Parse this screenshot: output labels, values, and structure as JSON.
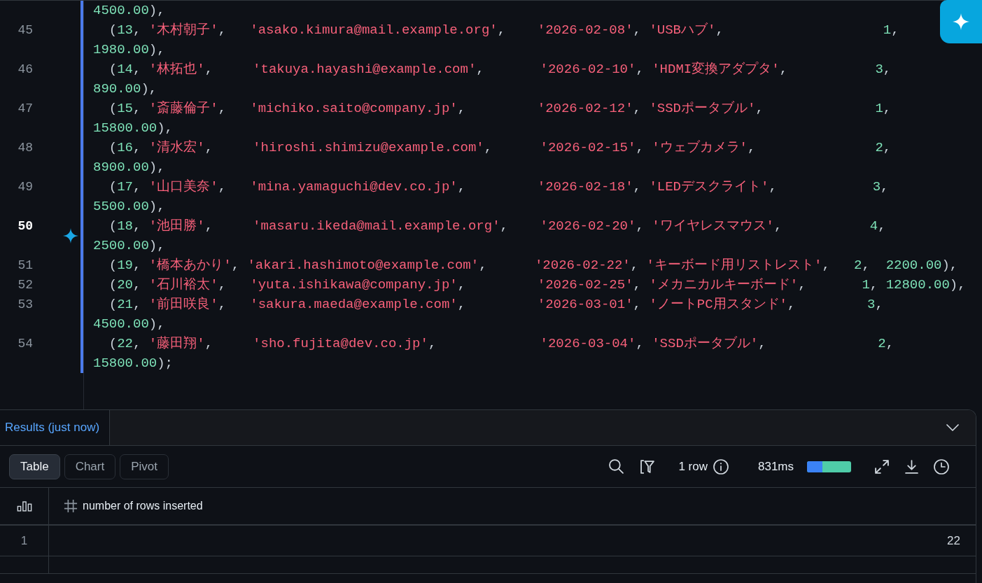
{
  "editor": {
    "lines": [
      {
        "tokens": [
          {
            "kind": "number",
            "text": "4500.00"
          },
          {
            "kind": "punct",
            "text": "),"
          }
        ]
      },
      {
        "number": "45",
        "current": false,
        "tokens": [
          {
            "kind": "punct",
            "text": "  ("
          },
          {
            "kind": "number",
            "text": "13"
          },
          {
            "kind": "punct",
            "text": ", "
          },
          {
            "kind": "string",
            "text": "'木村朝子'"
          },
          {
            "kind": "punct",
            "text": ",   "
          },
          {
            "kind": "string",
            "text": "'asako.kimura@mail.example.org'"
          },
          {
            "kind": "punct",
            "text": ",    "
          },
          {
            "kind": "string",
            "text": "'2026-02-08'"
          },
          {
            "kind": "punct",
            "text": ", "
          },
          {
            "kind": "string",
            "text": "'USBハブ'"
          },
          {
            "kind": "punct",
            "text": ",                    "
          },
          {
            "kind": "number",
            "text": "1"
          },
          {
            "kind": "punct",
            "text": ","
          }
        ],
        "wrapped": [
          {
            "kind": "number",
            "text": "1980.00"
          },
          {
            "kind": "punct",
            "text": "),"
          }
        ]
      },
      {
        "number": "46",
        "current": false,
        "tokens": [
          {
            "kind": "punct",
            "text": "  ("
          },
          {
            "kind": "number",
            "text": "14"
          },
          {
            "kind": "punct",
            "text": ", "
          },
          {
            "kind": "string",
            "text": "'林拓也'"
          },
          {
            "kind": "punct",
            "text": ",     "
          },
          {
            "kind": "string",
            "text": "'takuya.hayashi@example.com'"
          },
          {
            "kind": "punct",
            "text": ",       "
          },
          {
            "kind": "string",
            "text": "'2026-02-10'"
          },
          {
            "kind": "punct",
            "text": ", "
          },
          {
            "kind": "string",
            "text": "'HDMI変換アダプタ'"
          },
          {
            "kind": "punct",
            "text": ",           "
          },
          {
            "kind": "number",
            "text": "3"
          },
          {
            "kind": "punct",
            "text": ","
          }
        ],
        "wrapped": [
          {
            "kind": "number",
            "text": "890.00"
          },
          {
            "kind": "punct",
            "text": "),"
          }
        ]
      },
      {
        "number": "47",
        "current": false,
        "tokens": [
          {
            "kind": "punct",
            "text": "  ("
          },
          {
            "kind": "number",
            "text": "15"
          },
          {
            "kind": "punct",
            "text": ", "
          },
          {
            "kind": "string",
            "text": "'斎藤倫子'"
          },
          {
            "kind": "punct",
            "text": ",   "
          },
          {
            "kind": "string",
            "text": "'michiko.saito@company.jp'"
          },
          {
            "kind": "punct",
            "text": ",         "
          },
          {
            "kind": "string",
            "text": "'2026-02-12'"
          },
          {
            "kind": "punct",
            "text": ", "
          },
          {
            "kind": "string",
            "text": "'SSDポータブル'"
          },
          {
            "kind": "punct",
            "text": ",              "
          },
          {
            "kind": "number",
            "text": "1"
          },
          {
            "kind": "punct",
            "text": ","
          }
        ],
        "wrapped": [
          {
            "kind": "number",
            "text": "15800.00"
          },
          {
            "kind": "punct",
            "text": "),"
          }
        ]
      },
      {
        "number": "48",
        "current": false,
        "tokens": [
          {
            "kind": "punct",
            "text": "  ("
          },
          {
            "kind": "number",
            "text": "16"
          },
          {
            "kind": "punct",
            "text": ", "
          },
          {
            "kind": "string",
            "text": "'清水宏'"
          },
          {
            "kind": "punct",
            "text": ",     "
          },
          {
            "kind": "string",
            "text": "'hiroshi.shimizu@example.com'"
          },
          {
            "kind": "punct",
            "text": ",      "
          },
          {
            "kind": "string",
            "text": "'2026-02-15'"
          },
          {
            "kind": "punct",
            "text": ", "
          },
          {
            "kind": "string",
            "text": "'ウェブカメラ'"
          },
          {
            "kind": "punct",
            "text": ",               "
          },
          {
            "kind": "number",
            "text": "2"
          },
          {
            "kind": "punct",
            "text": ","
          }
        ],
        "wrapped": [
          {
            "kind": "number",
            "text": "8900.00"
          },
          {
            "kind": "punct",
            "text": "),"
          }
        ]
      },
      {
        "number": "49",
        "current": false,
        "tokens": [
          {
            "kind": "punct",
            "text": "  ("
          },
          {
            "kind": "number",
            "text": "17"
          },
          {
            "kind": "punct",
            "text": ", "
          },
          {
            "kind": "string",
            "text": "'山口美奈'"
          },
          {
            "kind": "punct",
            "text": ",   "
          },
          {
            "kind": "string",
            "text": "'mina.yamaguchi@dev.co.jp'"
          },
          {
            "kind": "punct",
            "text": ",         "
          },
          {
            "kind": "string",
            "text": "'2026-02-18'"
          },
          {
            "kind": "punct",
            "text": ", "
          },
          {
            "kind": "string",
            "text": "'LEDデスクライト'"
          },
          {
            "kind": "punct",
            "text": ",            "
          },
          {
            "kind": "number",
            "text": "3"
          },
          {
            "kind": "punct",
            "text": ","
          }
        ],
        "wrapped": [
          {
            "kind": "number",
            "text": "5500.00"
          },
          {
            "kind": "punct",
            "text": "),"
          }
        ]
      },
      {
        "number": "50",
        "current": true,
        "tokens": [
          {
            "kind": "punct",
            "text": "  ("
          },
          {
            "kind": "number",
            "text": "18"
          },
          {
            "kind": "punct",
            "text": ", "
          },
          {
            "kind": "string",
            "text": "'池田勝'"
          },
          {
            "kind": "punct",
            "text": ",     "
          },
          {
            "kind": "string",
            "text": "'masaru.ikeda@mail.example.org'"
          },
          {
            "kind": "punct",
            "text": ",    "
          },
          {
            "kind": "string",
            "text": "'2026-02-20'"
          },
          {
            "kind": "punct",
            "text": ", "
          },
          {
            "kind": "string",
            "text": "'ワイヤレスマウス'"
          },
          {
            "kind": "punct",
            "text": ",           "
          },
          {
            "kind": "number",
            "text": "4"
          },
          {
            "kind": "punct",
            "text": ","
          }
        ],
        "wrapped": [
          {
            "kind": "number",
            "text": "2500.00"
          },
          {
            "kind": "punct",
            "text": "),"
          }
        ]
      },
      {
        "number": "51",
        "current": false,
        "tokens": [
          {
            "kind": "punct",
            "text": "  ("
          },
          {
            "kind": "number",
            "text": "19"
          },
          {
            "kind": "punct",
            "text": ", "
          },
          {
            "kind": "string",
            "text": "'橋本あかり'"
          },
          {
            "kind": "punct",
            "text": ", "
          },
          {
            "kind": "string",
            "text": "'akari.hashimoto@example.com'"
          },
          {
            "kind": "punct",
            "text": ",      "
          },
          {
            "kind": "string",
            "text": "'2026-02-22'"
          },
          {
            "kind": "punct",
            "text": ", "
          },
          {
            "kind": "string",
            "text": "'キーボード用リストレスト'"
          },
          {
            "kind": "punct",
            "text": ",   "
          },
          {
            "kind": "number",
            "text": "2"
          },
          {
            "kind": "punct",
            "text": ",  "
          },
          {
            "kind": "number",
            "text": "2200.00"
          },
          {
            "kind": "punct",
            "text": "),"
          }
        ]
      },
      {
        "number": "52",
        "current": false,
        "tokens": [
          {
            "kind": "punct",
            "text": "  ("
          },
          {
            "kind": "number",
            "text": "20"
          },
          {
            "kind": "punct",
            "text": ", "
          },
          {
            "kind": "string",
            "text": "'石川裕太'"
          },
          {
            "kind": "punct",
            "text": ",   "
          },
          {
            "kind": "string",
            "text": "'yuta.ishikawa@company.jp'"
          },
          {
            "kind": "punct",
            "text": ",         "
          },
          {
            "kind": "string",
            "text": "'2026-02-25'"
          },
          {
            "kind": "punct",
            "text": ", "
          },
          {
            "kind": "string",
            "text": "'メカニカルキーボード'"
          },
          {
            "kind": "punct",
            "text": ",       "
          },
          {
            "kind": "number",
            "text": "1"
          },
          {
            "kind": "punct",
            "text": ", "
          },
          {
            "kind": "number",
            "text": "12800.00"
          },
          {
            "kind": "punct",
            "text": "),"
          }
        ]
      },
      {
        "number": "53",
        "current": false,
        "tokens": [
          {
            "kind": "punct",
            "text": "  ("
          },
          {
            "kind": "number",
            "text": "21"
          },
          {
            "kind": "punct",
            "text": ", "
          },
          {
            "kind": "string",
            "text": "'前田咲良'"
          },
          {
            "kind": "punct",
            "text": ",   "
          },
          {
            "kind": "string",
            "text": "'sakura.maeda@example.com'"
          },
          {
            "kind": "punct",
            "text": ",         "
          },
          {
            "kind": "string",
            "text": "'2026-03-01'"
          },
          {
            "kind": "punct",
            "text": ", "
          },
          {
            "kind": "string",
            "text": "'ノートPC用スタンド'"
          },
          {
            "kind": "punct",
            "text": ",         "
          },
          {
            "kind": "number",
            "text": "3"
          },
          {
            "kind": "punct",
            "text": ","
          }
        ],
        "wrapped": [
          {
            "kind": "number",
            "text": "4500.00"
          },
          {
            "kind": "punct",
            "text": "),"
          }
        ]
      },
      {
        "number": "54",
        "current": false,
        "tokens": [
          {
            "kind": "punct",
            "text": "  ("
          },
          {
            "kind": "number",
            "text": "22"
          },
          {
            "kind": "punct",
            "text": ", "
          },
          {
            "kind": "string",
            "text": "'藤田翔'"
          },
          {
            "kind": "punct",
            "text": ",     "
          },
          {
            "kind": "string",
            "text": "'sho.fujita@dev.co.jp'"
          },
          {
            "kind": "punct",
            "text": ",             "
          },
          {
            "kind": "string",
            "text": "'2026-03-04'"
          },
          {
            "kind": "punct",
            "text": ", "
          },
          {
            "kind": "string",
            "text": "'SSDポータブル'"
          },
          {
            "kind": "punct",
            "text": ",              "
          },
          {
            "kind": "number",
            "text": "2"
          },
          {
            "kind": "punct",
            "text": ","
          }
        ],
        "wrapped": [
          {
            "kind": "number",
            "text": "15800.00"
          },
          {
            "kind": "punct",
            "text": ");"
          }
        ]
      }
    ]
  },
  "results": {
    "tabs": [
      {
        "label": "Results (just now)",
        "selected": true
      }
    ],
    "views": [
      {
        "label": "Table",
        "selected": true
      },
      {
        "label": "Chart",
        "selected": false
      },
      {
        "label": "Pivot",
        "selected": false
      }
    ],
    "row_count": "1 row",
    "duration": "831ms",
    "timing_bar": {
      "level": 0.35
    },
    "table": {
      "columns": [
        {
          "label": "number of rows inserted"
        }
      ],
      "rows": [
        {
          "number": "1",
          "cells": [
            "22"
          ]
        }
      ]
    }
  }
}
